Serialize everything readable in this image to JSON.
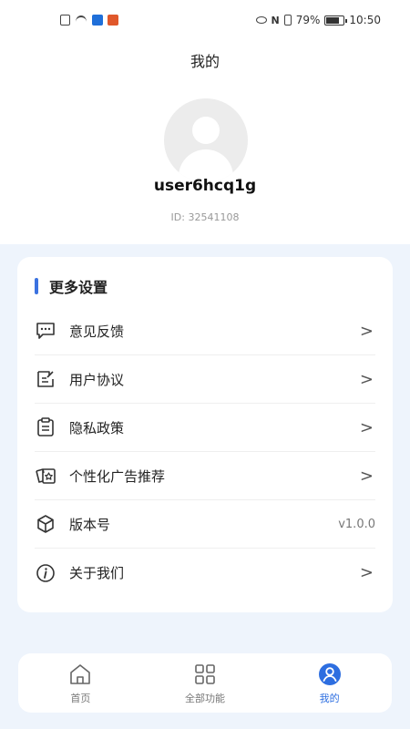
{
  "status_bar": {
    "battery": "79%",
    "time": "10:50"
  },
  "header": {
    "title": "我的"
  },
  "profile": {
    "username": "user6hcq1g",
    "user_id": "ID: 32541108"
  },
  "settings": {
    "title": "更多设置",
    "items": [
      {
        "label": "意见反馈",
        "icon": "message-icon"
      },
      {
        "label": "用户协议",
        "icon": "edit-document-icon"
      },
      {
        "label": "隐私政策",
        "icon": "clipboard-icon"
      },
      {
        "label": "个性化广告推荐",
        "icon": "cards-star-icon"
      },
      {
        "label": "版本号",
        "icon": "cube-icon",
        "value": "v1.0.0"
      },
      {
        "label": "关于我们",
        "icon": "info-icon"
      }
    ],
    "chevron": ">"
  },
  "nav": {
    "items": [
      {
        "label": "首页",
        "icon": "home-icon"
      },
      {
        "label": "全部功能",
        "icon": "grid-icon"
      },
      {
        "label": "我的",
        "icon": "profile-icon"
      }
    ],
    "active_color": "#2d6ee0"
  },
  "colors": {
    "accent": "#3b72e0",
    "background": "#eef4fc"
  }
}
